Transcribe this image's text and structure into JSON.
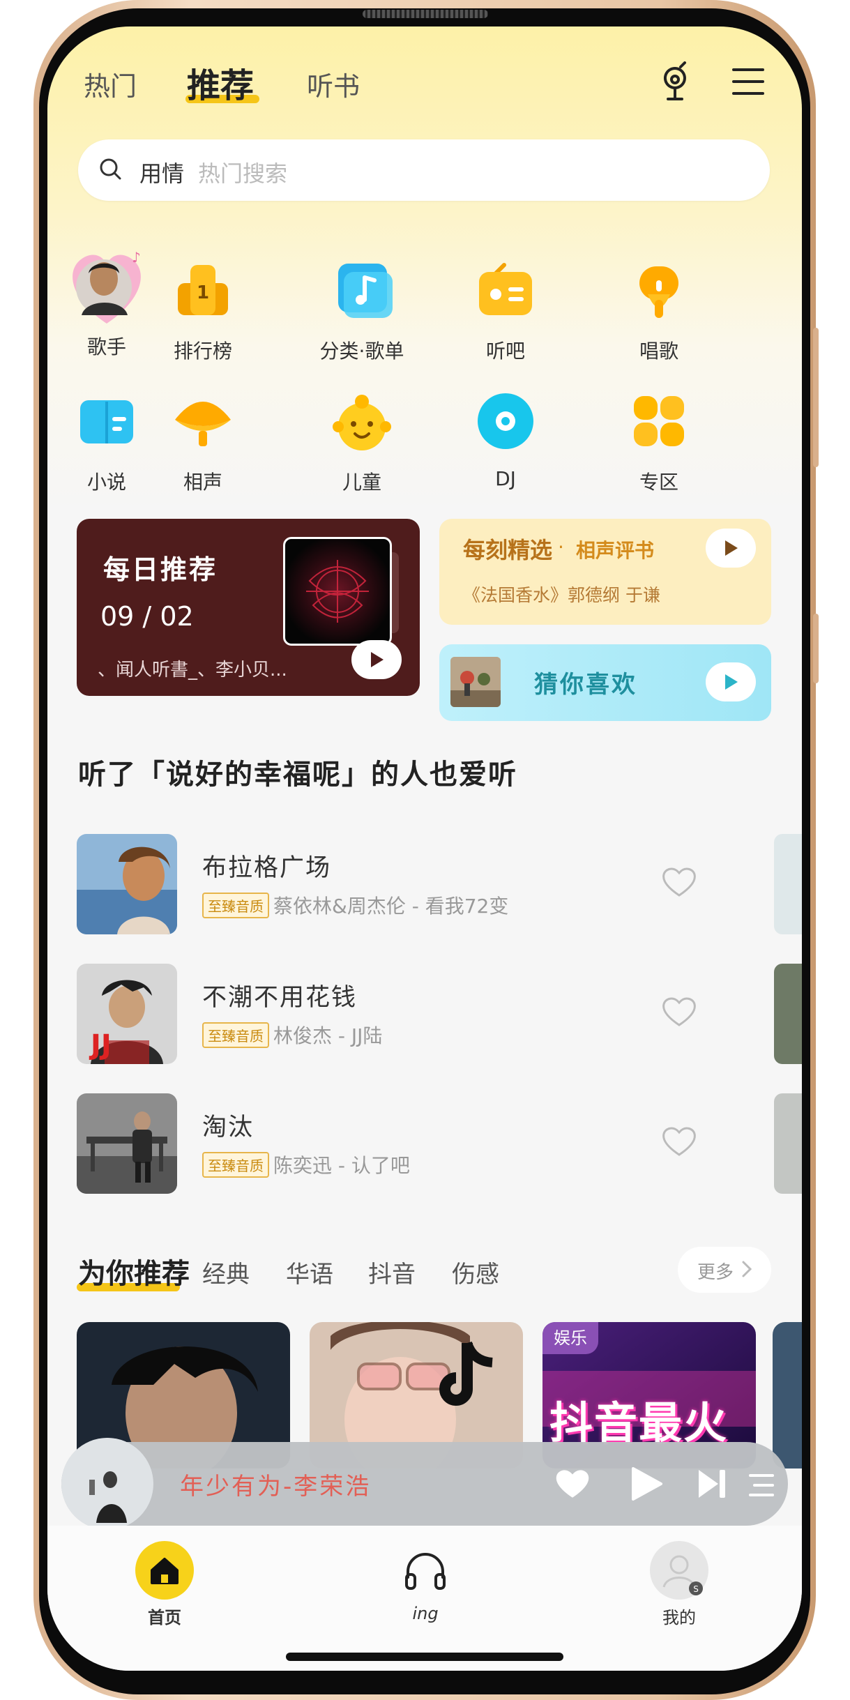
{
  "top_tabs": [
    {
      "label": "热门",
      "active": false
    },
    {
      "label": "推荐",
      "active": true
    },
    {
      "label": "听书",
      "active": false
    }
  ],
  "header_icons": {
    "voice": "voice-search-icon",
    "menu": "menu-icon"
  },
  "search": {
    "keyword": "用情",
    "placeholder": "热门搜索"
  },
  "categories_row1": [
    {
      "label": "歌手",
      "icon": "singer-avatar"
    },
    {
      "label": "排行榜",
      "icon": "ranking-icon"
    },
    {
      "label": "分类·歌单",
      "icon": "category-icon"
    },
    {
      "label": "听吧",
      "icon": "radio-icon"
    },
    {
      "label": "唱歌",
      "icon": "karaoke-icon"
    }
  ],
  "categories_row2": [
    {
      "label": "小说",
      "icon": "novel-icon"
    },
    {
      "label": "相声",
      "icon": "crosstalk-icon"
    },
    {
      "label": "儿童",
      "icon": "kids-icon"
    },
    {
      "label": "DJ",
      "icon": "dj-icon"
    },
    {
      "label": "专区",
      "icon": "zone-icon"
    }
  ],
  "daily": {
    "title": "每日推荐",
    "date": "09 / 02",
    "subtitle": "、闻人听書_、李小贝..."
  },
  "selection": {
    "title": "每刻精选",
    "dot": "·",
    "tag": "相声评书",
    "subtitle": "《法国香水》郭德纲 于谦"
  },
  "guess": {
    "title": "猜你喜欢"
  },
  "section_title": "听了「说好的幸福呢」的人也爱听",
  "quality_badge": "至臻音质",
  "songs": [
    {
      "title": "布拉格广场",
      "meta": "蔡依林&周杰伦 - 看我72变"
    },
    {
      "title": "不潮不用花钱",
      "meta": "林俊杰 - JJ陆"
    },
    {
      "title": "淘汰",
      "meta": "陈奕迅 - 认了吧"
    }
  ],
  "rec_tabs": [
    {
      "label": "为你推荐",
      "active": true
    },
    {
      "label": "经典",
      "active": false
    },
    {
      "label": "华语",
      "active": false
    },
    {
      "label": "抖音",
      "active": false
    },
    {
      "label": "伤感",
      "active": false
    }
  ],
  "more": "更多",
  "rec_cards": [
    {
      "tag": ""
    },
    {
      "tag": ""
    },
    {
      "tag": "娱乐",
      "overlay": "抖音最火"
    }
  ],
  "player": {
    "title": "年少有为-李荣浩"
  },
  "bottom_nav": [
    {
      "label": "首页",
      "active": true
    },
    {
      "label": "ing",
      "active": false
    },
    {
      "label": "我的",
      "active": false
    }
  ],
  "colors": {
    "accent": "#f5c518",
    "daily_bg": "#4f1c1c",
    "player_text": "#e25f55"
  }
}
